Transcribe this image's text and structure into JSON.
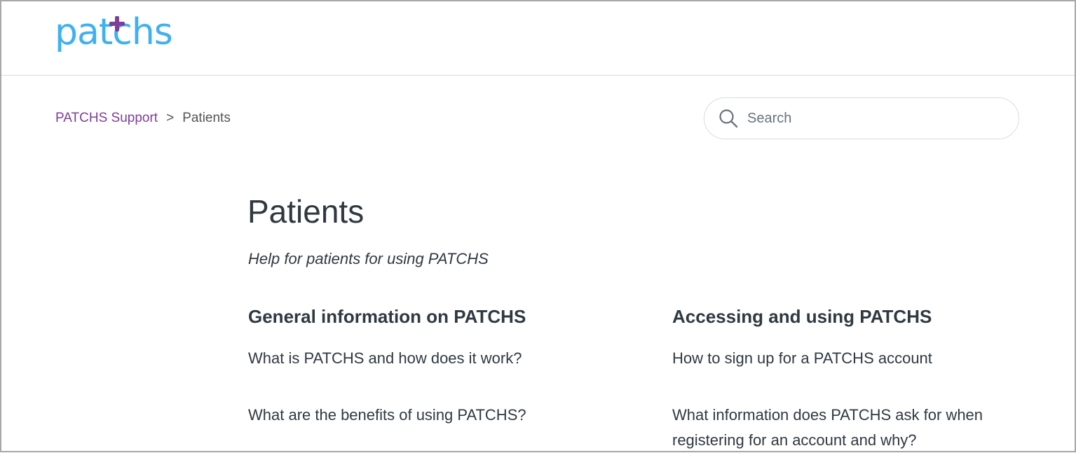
{
  "header": {
    "logo_text": "patchs",
    "logo_colors": {
      "main": "#3eb1f0",
      "plus": "#7d3f98"
    }
  },
  "breadcrumbs": {
    "items": [
      "PATCHS Support",
      "Patients"
    ],
    "separator": ">"
  },
  "search": {
    "placeholder": "Search",
    "value": ""
  },
  "page": {
    "title": "Patients",
    "description": "Help for patients for using PATCHS"
  },
  "sections": [
    {
      "title": "General information on PATCHS",
      "articles": [
        "What is PATCHS and how does it work?",
        "What are the benefits of using PATCHS?"
      ]
    },
    {
      "title": "Accessing and using PATCHS",
      "articles": [
        "How to sign up for a PATCHS account",
        "What information does PATCHS ask for when registering for an account and why?"
      ]
    }
  ],
  "colors": {
    "accent": "#7d3f98",
    "text": "#2f3941",
    "border": "#d8dcde"
  }
}
